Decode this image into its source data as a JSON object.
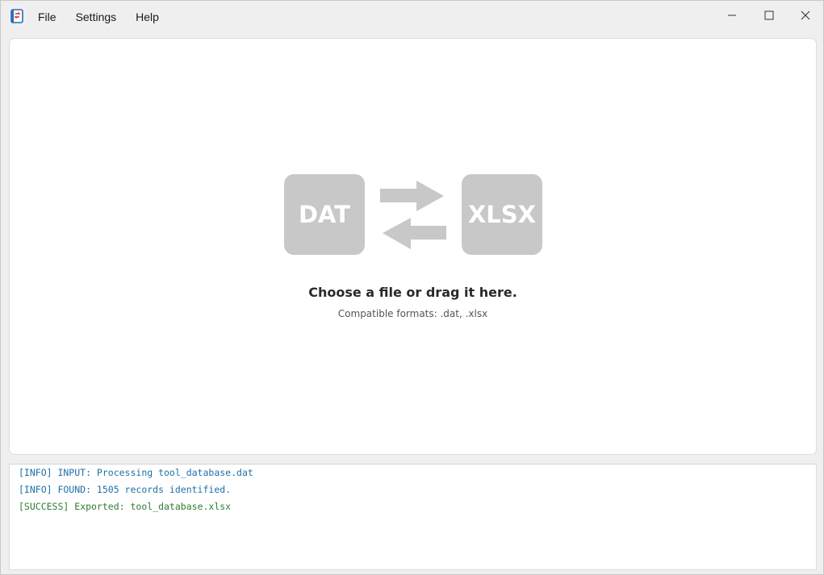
{
  "menu": {
    "items": [
      "File",
      "Settings",
      "Help"
    ]
  },
  "window_controls": {
    "minimize_icon": "minimize-icon",
    "maximize_icon": "maximize-icon",
    "close_icon": "close-icon"
  },
  "dropzone": {
    "source_badge": "DAT",
    "target_badge": "XLSX",
    "title": "Choose a file or drag it here.",
    "subtitle": "Compatible formats: .dat, .xlsx",
    "arrows_icon": "swap-arrows-icon"
  },
  "log": {
    "lines": [
      {
        "level": "info",
        "text": "[INFO] INPUT: Processing tool_database.dat"
      },
      {
        "level": "info",
        "text": "[INFO] FOUND: 1505 records identified."
      },
      {
        "level": "success",
        "text": "[SUCCESS] Exported: tool_database.xlsx"
      }
    ]
  },
  "colors": {
    "badge": "#c8c8c8",
    "info_text": "#1f6fa8",
    "success_text": "#2e7d32"
  }
}
